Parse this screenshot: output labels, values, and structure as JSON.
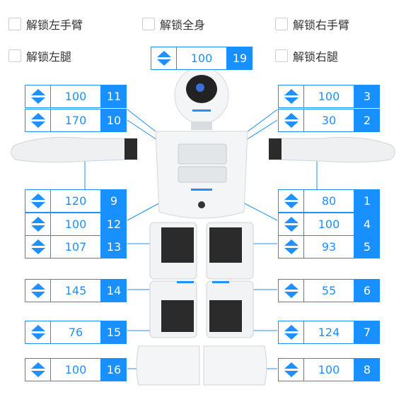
{
  "checkboxes": {
    "unlock_left_arm": "解锁左手臂",
    "unlock_whole_body": "解锁全身",
    "unlock_right_arm": "解锁右手臂",
    "unlock_left_leg": "解锁左腿",
    "unlock_right_leg": "解锁右腿"
  },
  "servos": {
    "s19": {
      "value": "100",
      "id": "19"
    },
    "s11": {
      "value": "100",
      "id": "11"
    },
    "s10": {
      "value": "170",
      "id": "10"
    },
    "s9": {
      "value": "120",
      "id": "9"
    },
    "s12": {
      "value": "100",
      "id": "12"
    },
    "s13": {
      "value": "107",
      "id": "13"
    },
    "s14": {
      "value": "145",
      "id": "14"
    },
    "s15": {
      "value": "76",
      "id": "15"
    },
    "s16": {
      "value": "100",
      "id": "16"
    },
    "s3": {
      "value": "100",
      "id": "3"
    },
    "s2": {
      "value": "30",
      "id": "2"
    },
    "s1": {
      "value": "80",
      "id": "1"
    },
    "s4": {
      "value": "100",
      "id": "4"
    },
    "s5": {
      "value": "93",
      "id": "5"
    },
    "s6": {
      "value": "55",
      "id": "6"
    },
    "s7": {
      "value": "124",
      "id": "7"
    },
    "s8": {
      "value": "100",
      "id": "8"
    }
  },
  "colors": {
    "accent": "#1890ff",
    "robot_body": "#f2f4f6",
    "robot_dark": "#2b2b2b"
  }
}
